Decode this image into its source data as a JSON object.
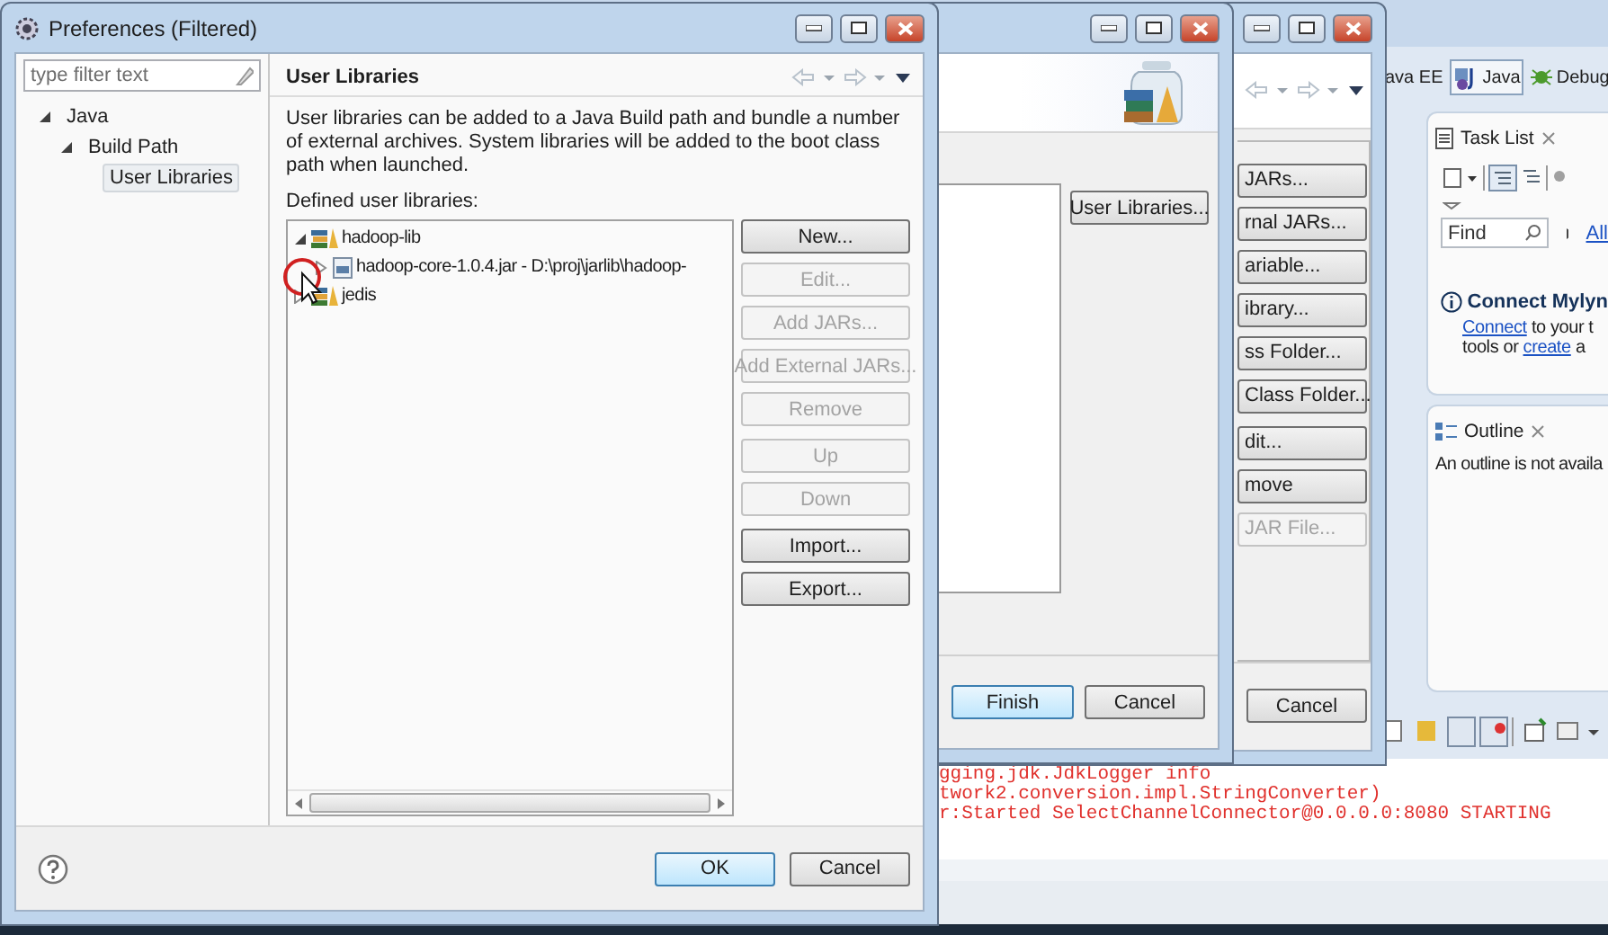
{
  "ide": {
    "perspectives": [
      {
        "label": "ava EE",
        "selected": false,
        "kind": "plain"
      },
      {
        "label": "Java",
        "selected": true,
        "kind": "java"
      },
      {
        "label": "Debug",
        "selected": false,
        "kind": "debug"
      }
    ],
    "task_list": {
      "tab": "Task List",
      "find": {
        "placeholder": "Find"
      },
      "all_link": "All",
      "mylyn_title": "Connect Mylyn",
      "mylyn_line_1": [
        "Connect",
        " to your t"
      ],
      "mylyn_line_2": [
        "tools or ",
        "create",
        " a"
      ]
    },
    "outline": {
      "tab": "Outline",
      "message": "An outline is not availa"
    },
    "console": [
      "gging.jdk.JdkLogger info",
      "twork2.conversion.impl.StringConverter)",
      "r:Started SelectChannelConnector@0.0.0.0:8080 STARTING"
    ]
  },
  "wizard_back": {
    "button_groups": [
      [
        {
          "label": "JARs...",
          "disabled": false
        },
        {
          "label": "rnal JARs...",
          "disabled": false
        },
        {
          "label": "ariable...",
          "disabled": false
        },
        {
          "label": "ibrary...",
          "disabled": false
        },
        {
          "label": "ss Folder...",
          "disabled": false
        },
        {
          "label": "Class Folder...",
          "disabled": false
        }
      ],
      [
        {
          "label": "dit...",
          "disabled": false
        },
        {
          "label": "move",
          "disabled": false
        },
        {
          "label": "JAR File...",
          "disabled": true
        }
      ]
    ],
    "cancel": "Cancel"
  },
  "wizard_front": {
    "user_libraries_button": "User Libraries...",
    "finish": "Finish",
    "cancel": "Cancel"
  },
  "preferences": {
    "title": "Preferences (Filtered)",
    "filter": {
      "placeholder": "type filter text"
    },
    "nav_tree": [
      {
        "label": "Java",
        "expanded": true,
        "selected": false,
        "children": [
          {
            "label": "Build Path",
            "expanded": true,
            "selected": false,
            "children": [
              {
                "label": "User Libraries",
                "selected": true
              }
            ]
          }
        ]
      }
    ],
    "page_title": "User Libraries",
    "description": "User libraries can be added to a Java Build path and bundle a number of external archives. System libraries will be added to the boot class path when launched.",
    "list_label": "Defined user libraries:",
    "libraries": [
      {
        "label": "hadoop-lib",
        "kind": "library",
        "expanded": true,
        "children": [
          {
            "label": "hadoop-core-1.0.4.jar - D:\\proj\\jarlib\\hadoop-",
            "kind": "jar",
            "expanded": false
          }
        ]
      },
      {
        "label": "jedis",
        "kind": "library",
        "expanded": false
      }
    ],
    "button_groups": [
      [
        {
          "label": "New...",
          "disabled": false
        },
        {
          "label": "Edit...",
          "disabled": true
        },
        {
          "label": "Add JARs...",
          "disabled": true
        },
        {
          "label": "Add External JARs...",
          "disabled": true
        },
        {
          "label": "Remove",
          "disabled": true
        }
      ],
      [
        {
          "label": "Up",
          "disabled": true
        },
        {
          "label": "Down",
          "disabled": true
        }
      ],
      [
        {
          "label": "Import...",
          "disabled": false
        },
        {
          "label": "Export...",
          "disabled": false
        }
      ]
    ],
    "ok": "OK",
    "cancel": "Cancel"
  }
}
